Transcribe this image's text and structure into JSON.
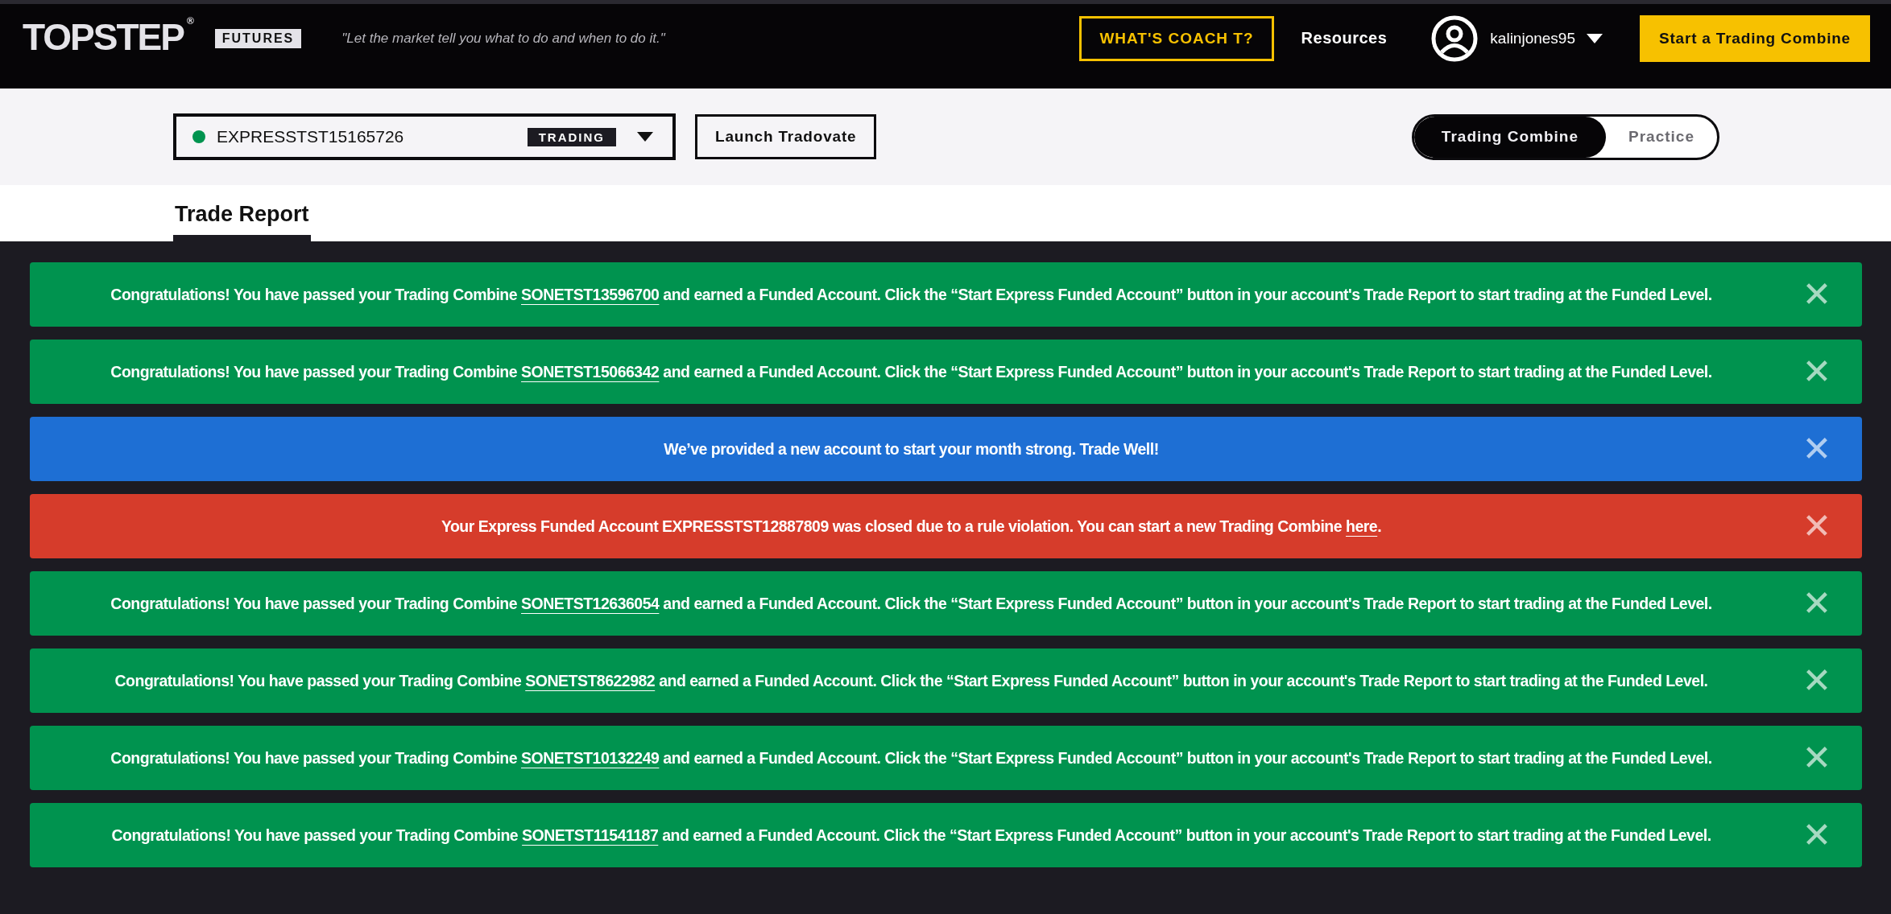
{
  "header": {
    "logo": "TOPSTEP",
    "logo_mark": "®",
    "badge": "FUTURES",
    "tagline": "\"Let the market tell you what to do and when to do it.\"",
    "coach_button": "WHAT'S COACH T?",
    "resources_link": "Resources",
    "username": "kalinjones95",
    "cta_button": "Start a Trading Combine"
  },
  "account_bar": {
    "account": {
      "name": "EXPRESSTST15165726",
      "status": "TRADING",
      "active": true
    },
    "launch_button": "Launch Tradovate",
    "mode_toggle": [
      {
        "label": "Trading Combine",
        "selected": true
      },
      {
        "label": "Practice",
        "selected": false
      }
    ]
  },
  "tabs": [
    {
      "label": "Trade Report",
      "selected": true
    }
  ],
  "alerts": [
    {
      "kind": "success",
      "before": "Congratulations! You have passed your Trading Combine ",
      "link": "SONETST13596700",
      "after": " and earned a Funded Account. Click the “Start Express Funded Account” button in your account's Trade Report to start trading at the Funded Level.",
      "close": "✕"
    },
    {
      "kind": "success",
      "before": "Congratulations! You have passed your Trading Combine ",
      "link": "SONETST15066342",
      "after": " and earned a Funded Account. Click the “Start Express Funded Account” button in your account's Trade Report to start trading at the Funded Level.",
      "close": "✕"
    },
    {
      "kind": "info",
      "before": "We’ve provided a new account to start your month strong. Trade Well!",
      "close": "✕"
    },
    {
      "kind": "error",
      "before": "Your Express Funded Account EXPRESSTST12887809 was closed due to a rule violation. You can start a new Trading Combine ",
      "link": "here",
      "after": ".",
      "close": "✕"
    },
    {
      "kind": "success",
      "before": "Congratulations! You have passed your Trading Combine ",
      "link": "SONETST12636054",
      "after": " and earned a Funded Account. Click the “Start Express Funded Account” button in your account's Trade Report to start trading at the Funded Level.",
      "close": "✕"
    },
    {
      "kind": "success",
      "before": "Congratulations! You have passed your Trading Combine ",
      "link": "SONETST8622982",
      "after": " and earned a Funded Account. Click the “Start Express Funded Account” button in your account's Trade Report to start trading at the Funded Level.",
      "close": "✕"
    },
    {
      "kind": "success",
      "before": "Congratulations! You have passed your Trading Combine ",
      "link": "SONETST10132249",
      "after": " and earned a Funded Account. Click the “Start Express Funded Account” button in your account's Trade Report to start trading at the Funded Level.",
      "close": "✕"
    },
    {
      "kind": "success",
      "before": "Congratulations! You have passed your Trading Combine ",
      "link": "SONETST11541187",
      "after": " and earned a Funded Account. Click the “Start Express Funded Account” button in your account's Trade Report to start trading at the Funded Level.",
      "close": "✕"
    }
  ]
}
